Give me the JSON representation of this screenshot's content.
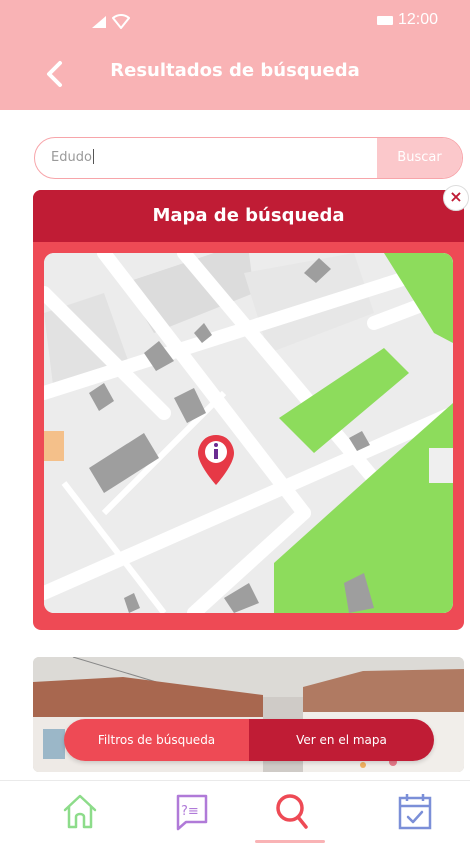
{
  "status_bar": {
    "time": "12:00"
  },
  "header": {
    "title": "Resultados de búsqueda"
  },
  "search": {
    "value": "Edudo",
    "button_label": "Buscar"
  },
  "modal": {
    "title": "Mapa de búsqueda",
    "close_label": "×"
  },
  "toggle": {
    "filters_label": "Filtros de búsqueda",
    "map_label": "Ver en el mapa"
  },
  "colors": {
    "primary": "#c01c35",
    "accent": "#ee4a55",
    "light_pink": "#f9b3b5",
    "park_green": "#8ddc5c",
    "water_blue": "#7ad8f0"
  },
  "icons": [
    "back-arrow-icon",
    "signal-icon",
    "wifi-icon",
    "battery-icon",
    "map-pin-info-icon",
    "close-icon",
    "home-icon",
    "faq-icon",
    "search-icon",
    "calendar-check-icon"
  ]
}
